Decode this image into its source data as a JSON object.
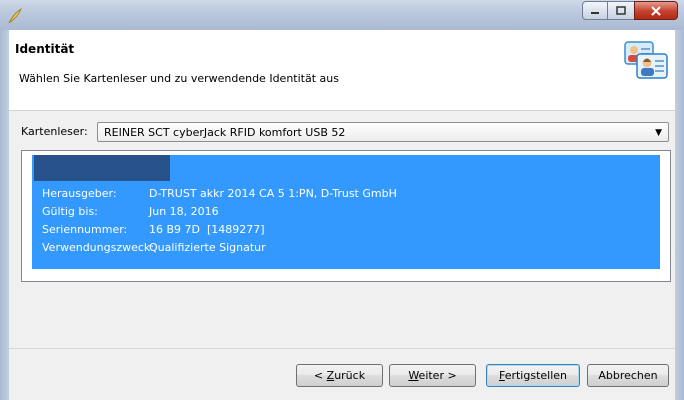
{
  "window": {
    "title": "",
    "controls": [
      "minimize-icon",
      "maximize-icon",
      "close-icon"
    ]
  },
  "header": {
    "title": "Identität",
    "subtitle": "Wählen Sie Kartenleser und zu verwendende Identität aus",
    "icon": "identity-cards-icon"
  },
  "reader": {
    "label": "Kartenleser:",
    "selected": "REINER SCT cyberJack RFID komfort USB 52"
  },
  "identity": {
    "rows": [
      {
        "key": "Herausgeber:",
        "value": "D-TRUST akkr 2014 CA 5 1:PN, D-Trust GmbH"
      },
      {
        "key": "Gültig bis:",
        "value": "Jun 18, 2016"
      },
      {
        "key": "Seriennummer:",
        "value": "16 B9 7D  [1489277]"
      },
      {
        "key": "Verwendungszweck:",
        "value": "Qualifizierte Signatur"
      }
    ]
  },
  "buttons": {
    "back": {
      "mnemonic": "Z",
      "rest": "urück",
      "prefix": "< "
    },
    "next": {
      "mnemonic": "W",
      "rest": "eiter >"
    },
    "finish": {
      "mnemonic": "F",
      "rest": "ertigstellen"
    },
    "cancel": {
      "label": "Abbrechen"
    }
  },
  "colors": {
    "selection": "#3399ff",
    "redacted": "#27528c",
    "close": "#c4412d"
  }
}
